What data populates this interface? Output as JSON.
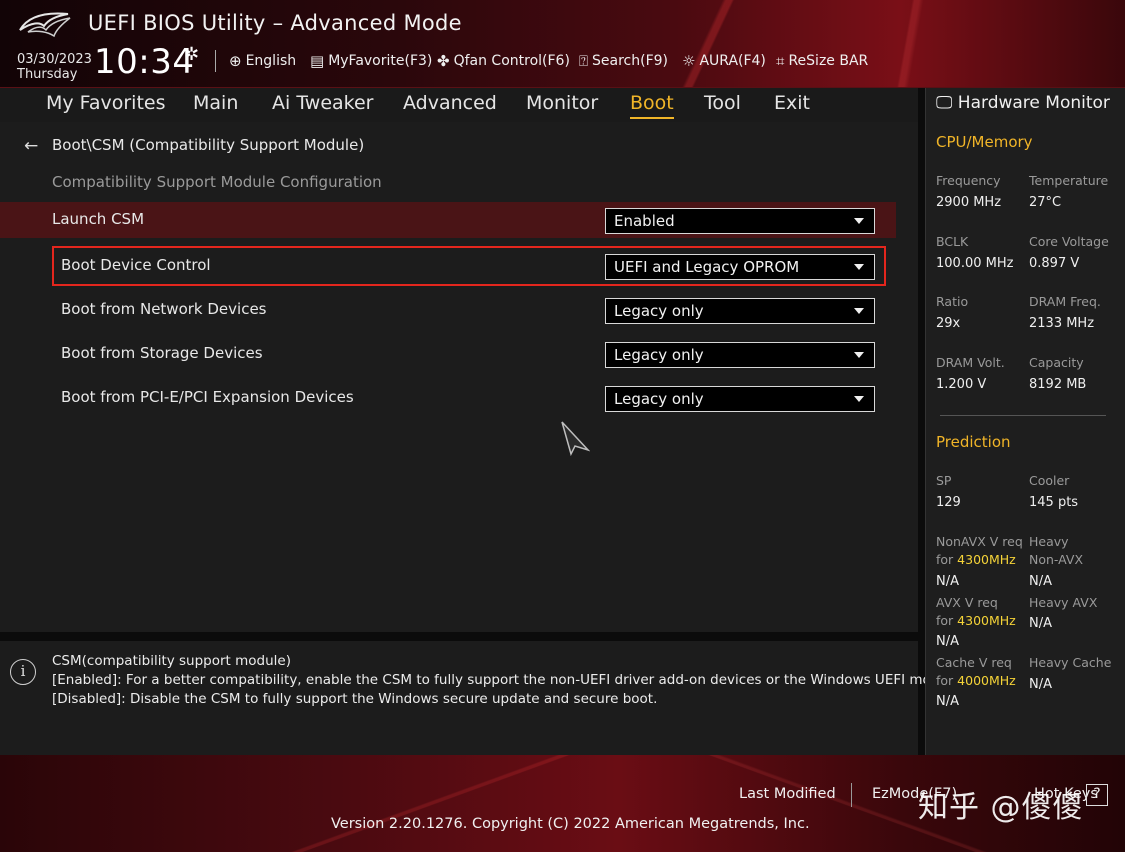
{
  "header": {
    "title": "UEFI BIOS Utility – Advanced Mode",
    "date": "03/30/2023",
    "weekday": "Thursday",
    "time": "10:34",
    "tools": [
      {
        "label": "English",
        "icon": "globe-icon"
      },
      {
        "label": "MyFavorite(F3)",
        "icon": "favorite-icon"
      },
      {
        "label": "Qfan Control(F6)",
        "icon": "fan-icon"
      },
      {
        "label": "Search(F9)",
        "icon": "search-help-icon"
      },
      {
        "label": "AURA(F4)",
        "icon": "aura-icon"
      },
      {
        "label": "ReSize BAR",
        "icon": "resize-bar-icon"
      }
    ]
  },
  "nav": {
    "tabs": [
      "My Favorites",
      "Main",
      "Ai Tweaker",
      "Advanced",
      "Monitor",
      "Boot",
      "Tool",
      "Exit"
    ],
    "active": "Boot"
  },
  "main": {
    "breadcrumb": "Boot\\CSM (Compatibility Support Module)",
    "subtitle": "Compatibility Support Module Configuration",
    "settings": [
      {
        "label": "Launch CSM",
        "value": "Enabled"
      },
      {
        "label": "Boot Device Control",
        "value": "UEFI and Legacy OPROM"
      },
      {
        "label": "Boot from Network Devices",
        "value": "Legacy only"
      },
      {
        "label": "Boot from Storage Devices",
        "value": "Legacy only"
      },
      {
        "label": "Boot from PCI-E/PCI Expansion Devices",
        "value": "Legacy only"
      }
    ]
  },
  "help": {
    "icon_glyph": "i",
    "lines": [
      "CSM(compatibility support module)",
      "[Enabled]: For a better compatibility, enable the CSM to fully support the non-UEFI driver add-on devices or the Windows UEFI mode.",
      "[Disabled]: Disable the CSM to fully support the Windows secure update and secure boot."
    ]
  },
  "hw_monitor": {
    "title": "Hardware Monitor",
    "cpu_memory": {
      "heading": "CPU/Memory",
      "items": [
        {
          "label": "Frequency",
          "value": "2900 MHz"
        },
        {
          "label": "Temperature",
          "value": "27°C"
        },
        {
          "label": "BCLK",
          "value": "100.00 MHz"
        },
        {
          "label": "Core Voltage",
          "value": "0.897 V"
        },
        {
          "label": "Ratio",
          "value": "29x"
        },
        {
          "label": "DRAM Freq.",
          "value": "2133 MHz"
        },
        {
          "label": "DRAM Volt.",
          "value": "1.200 V"
        },
        {
          "label": "Capacity",
          "value": "8192 MB"
        }
      ]
    },
    "prediction": {
      "heading": "Prediction",
      "sp_label": "SP",
      "sp_value": "129",
      "cooler_label": "Cooler",
      "cooler_value": "145 pts",
      "nonavx_label": "NonAVX V req",
      "nonavx_for": "for",
      "nonavx_freq": "4300MHz",
      "nonavx_value": "N/A",
      "heavy_nonavx_label1": "Heavy",
      "heavy_nonavx_label2": "Non-AVX",
      "heavy_nonavx_value": "N/A",
      "avx_label": "AVX V req",
      "avx_for": "for",
      "avx_freq": "4300MHz",
      "avx_value": "N/A",
      "heavy_avx_label": "Heavy AVX",
      "heavy_avx_value": "N/A",
      "cache_label": "Cache V req",
      "cache_for": "for",
      "cache_freq": "4000MHz",
      "cache_value": "N/A",
      "heavy_cache_label": "Heavy Cache",
      "heavy_cache_value": "N/A"
    }
  },
  "footer": {
    "last_modified": "Last Modified",
    "ezmode": "EzMode(F7)",
    "hotkeys": "Hot Keys",
    "version": "Version 2.20.1276. Copyright (C) 2022 American Megatrends, Inc.",
    "watermark": "知乎 @傻傻"
  },
  "colors": {
    "accent": "#f1b528",
    "selection_border": "#e3261d",
    "highlight_row": "#4a1416",
    "prediction_freq": "#f5d338"
  }
}
